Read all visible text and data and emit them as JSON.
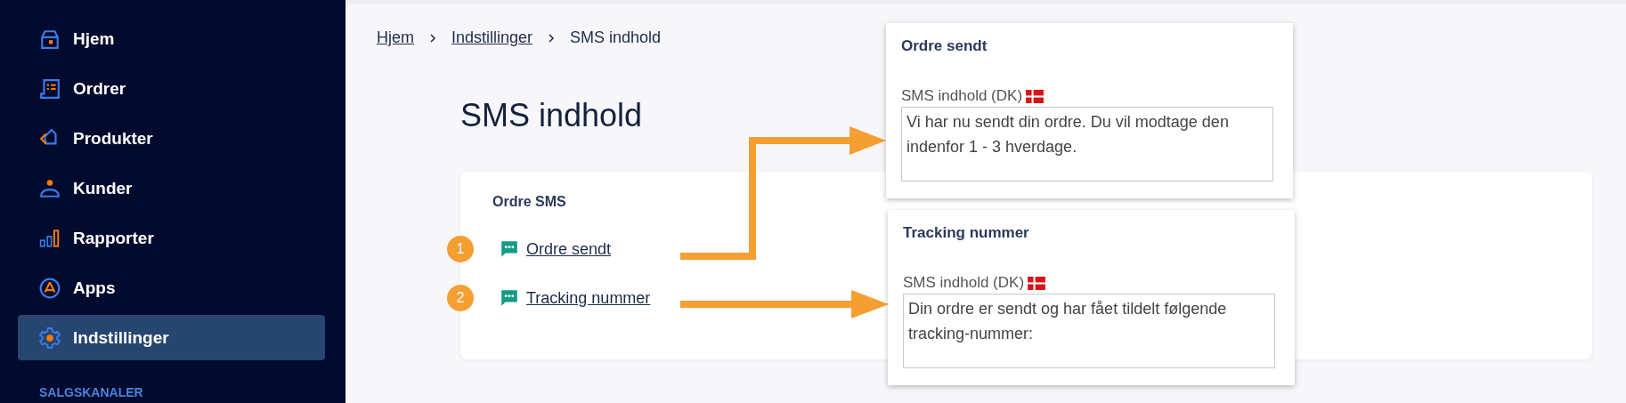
{
  "sidebar": {
    "items": [
      {
        "label": "Hjem",
        "selected": false
      },
      {
        "label": "Ordrer",
        "selected": false
      },
      {
        "label": "Produkter",
        "selected": false
      },
      {
        "label": "Kunder",
        "selected": false
      },
      {
        "label": "Rapporter",
        "selected": false
      },
      {
        "label": "Apps",
        "selected": false
      },
      {
        "label": "Indstillinger",
        "selected": true
      }
    ],
    "section_heading": "SALGSKANALER"
  },
  "breadcrumb": [
    {
      "label": "Hjem",
      "current": false
    },
    {
      "label": "Indstillinger",
      "current": false
    },
    {
      "label": "SMS indhold",
      "current": true
    }
  ],
  "page_title": "SMS indhold",
  "card": {
    "title": "Ordre SMS",
    "items": [
      {
        "number": "1",
        "label": "Ordre sendt"
      },
      {
        "number": "2",
        "label": "Tracking nummer"
      }
    ]
  },
  "popups": [
    {
      "title": "Ordre sendt",
      "field_label": "SMS indhold (DK)",
      "value": "Vi har nu sendt din ordre. Du vil modtage den indenfor 1 - 3 hverdage."
    },
    {
      "title": "Tracking nummer",
      "field_label": "SMS indhold (DK)",
      "value": "Din ordre er sendt og har fået tildelt følgende tracking-nummer:"
    }
  ]
}
